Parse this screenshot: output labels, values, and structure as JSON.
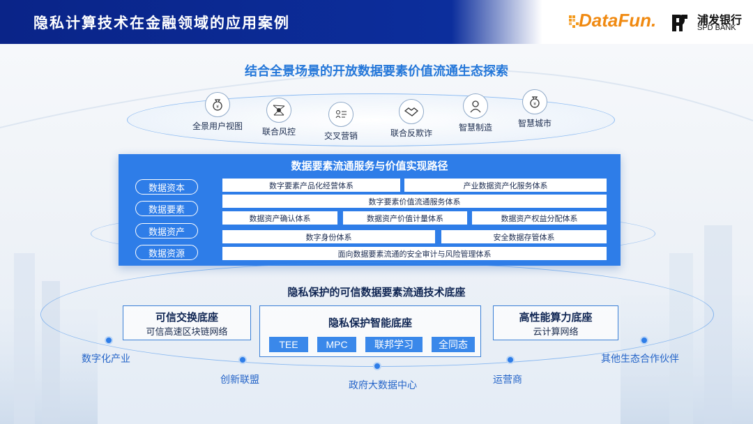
{
  "header": {
    "title": "隐私计算技术在金融领域的应用案例",
    "logo_datafun": "DataFun.",
    "logo_spd_cn": "浦发银行",
    "logo_spd_en": "SPD BANK"
  },
  "headline": "结合全景场景的开放数据要素价值流通生态探索",
  "scenarios": [
    {
      "label": "全景用户视图",
      "icon": "money-bag-icon"
    },
    {
      "label": "联合风控",
      "icon": "network-icon"
    },
    {
      "label": "交叉营销",
      "icon": "marketing-icon"
    },
    {
      "label": "联合反欺诈",
      "icon": "handshake-icon"
    },
    {
      "label": "智慧制造",
      "icon": "worker-icon"
    },
    {
      "label": "智慧城市",
      "icon": "money-bag-icon"
    }
  ],
  "service": {
    "title": "数据要素流通服务与价值实现路径",
    "levels": [
      "数据资本",
      "数据要素",
      "数据资产",
      "数据资源"
    ],
    "rows": [
      [
        "数字要素产品化经营体系",
        "产业数据资产化服务体系"
      ],
      [
        "数字要素价值流通服务体系"
      ],
      [
        "数据资产确认体系",
        "数据资产价值计量体系",
        "数据资产权益分配体系"
      ],
      [
        "数字身份体系",
        "安全数据存管体系"
      ],
      [
        "面向数据要素流通的安全审计与风险管理体系"
      ]
    ]
  },
  "base": {
    "title": "隐私保护的可信数据要素流通技术底座",
    "left": {
      "title": "可信交换底座",
      "sub": "可信高速区块链网络"
    },
    "center": {
      "title": "隐私保护智能底座",
      "chips": [
        "TEE",
        "MPC",
        "联邦学习",
        "全同态"
      ]
    },
    "right": {
      "title": "高性能算力底座",
      "sub": "云计算网络"
    }
  },
  "partners": [
    "数字化产业",
    "创新联盟",
    "政府大数据中心",
    "运营商",
    "其他生态合作伙伴"
  ],
  "colors": {
    "primary": "#2e7de8",
    "header": "#0c2e9c",
    "accent": "#2477d9",
    "datafun": "#f08a12"
  }
}
